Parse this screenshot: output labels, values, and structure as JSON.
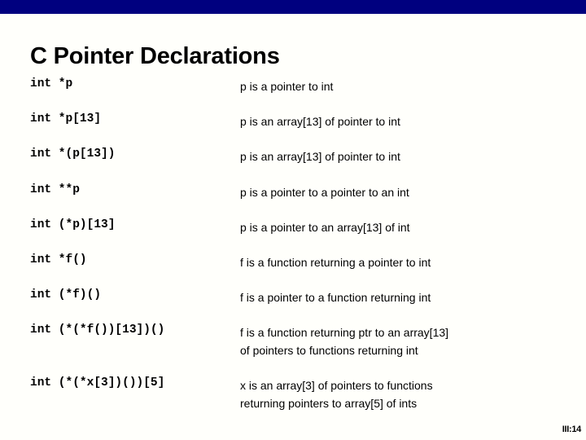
{
  "slide": {
    "title": "C Pointer Declarations",
    "banner_color": "#00007f",
    "background_color": "#fffffb",
    "text_color": "#000000",
    "slide_number": "III:14"
  },
  "rows": [
    {
      "code": "int *p",
      "desc_line1": "p is a pointer to int",
      "desc_line2": ""
    },
    {
      "code": "int *p[13]",
      "desc_line1": "p is an array[13] of pointer to int",
      "desc_line2": ""
    },
    {
      "code": "int *(p[13])",
      "desc_line1": "p is an array[13] of pointer to int",
      "desc_line2": ""
    },
    {
      "code": "int **p",
      "desc_line1": "p is a pointer to a pointer to an int",
      "desc_line2": ""
    },
    {
      "code": "int (*p)[13]",
      "desc_line1": "p is a pointer to an array[13] of int",
      "desc_line2": ""
    },
    {
      "code": "int *f()",
      "desc_line1": "f is a function returning a pointer to int",
      "desc_line2": ""
    },
    {
      "code": "int (*f)()",
      "desc_line1": "f is a pointer to a function returning int",
      "desc_line2": ""
    },
    {
      "code": "int (*(*f())[13])()",
      "desc_line1": "f is a function returning ptr to an array[13]",
      "desc_line2": "of pointers to functions returning int"
    },
    {
      "code": "int (*(*x[3])())[5]",
      "desc_line1": "x is an array[3] of pointers  to functions",
      "desc_line2": "returning pointers to array[5] of ints"
    }
  ]
}
